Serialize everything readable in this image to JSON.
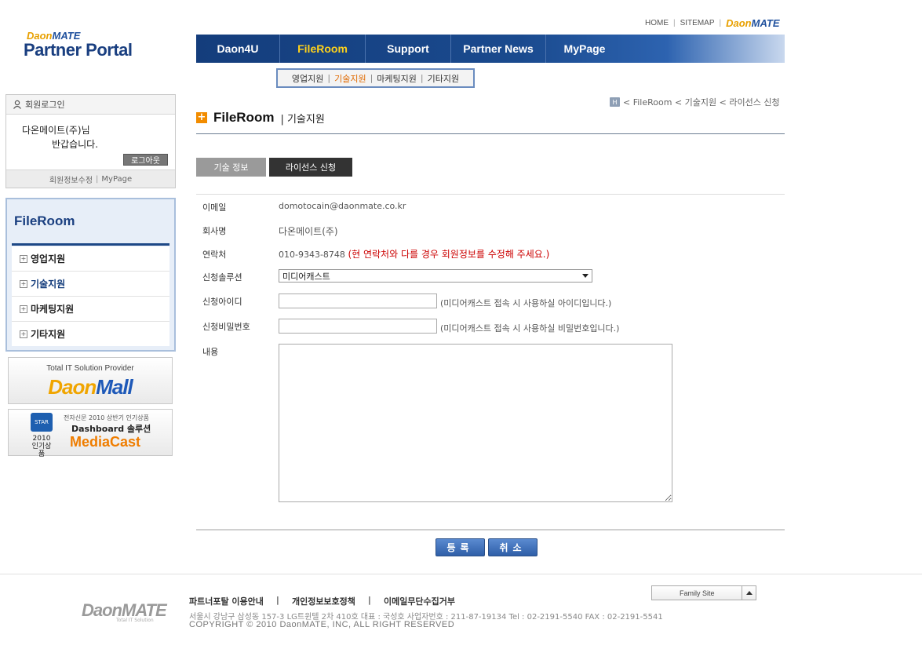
{
  "top_links": {
    "home": "HOME",
    "sitemap": "SITEMAP",
    "brand_a": "Daon",
    "brand_b": "MATE"
  },
  "logo": {
    "small_a": "Daon",
    "small_b": "MATE",
    "title": "Partner Portal"
  },
  "main_nav": [
    {
      "label": "Daon4U",
      "active": false
    },
    {
      "label": "FileRoom",
      "active": true
    },
    {
      "label": "Support",
      "active": false
    },
    {
      "label": "Partner News",
      "active": false
    },
    {
      "label": "MyPage",
      "active": false
    }
  ],
  "sub_nav": [
    "영업지원",
    "기술지원",
    "마케팅지원",
    "기타지원"
  ],
  "login": {
    "header": "회원로그인",
    "name": "다온메이트(주)님",
    "greeting": "반갑습니다.",
    "logout": "로그아웃",
    "edit_info": "회원정보수정",
    "mypage": "MyPage"
  },
  "side_menu": {
    "title": "FileRoom",
    "items": [
      "영업지원",
      "기술지원",
      "마케팅지원",
      "기타지원"
    ]
  },
  "banner1": {
    "line1": "Total IT Solution Provider",
    "logo_a": "Daon",
    "logo_b": "Mall"
  },
  "banner2": {
    "badge": "STAR",
    "year": "2010",
    "badge_sub": "인기상품",
    "line1": "전자신문 2010 상반기 인기상품",
    "line2": "Dashboard 솔루션",
    "line3": "MediaCast"
  },
  "breadcrumb": {
    "home_icon": "H",
    "path": "< FileRoom < 기술지원 < 라이선스 신청"
  },
  "page_title": {
    "main": "FileRoom",
    "sub": "| 기술지원"
  },
  "tabs": [
    {
      "label": "기술 정보",
      "active": false
    },
    {
      "label": "라이선스 신청",
      "active": true
    }
  ],
  "form": {
    "email_label": "이메일",
    "email_value": "domotocain@daonmate.co.kr",
    "company_label": "회사명",
    "company_value": "다온메이트(주)",
    "contact_label": "연락처",
    "contact_value": "010-9343-8748",
    "contact_warning": "(현 연락처와 다를 경우 회원정보를 수정해 주세요.)",
    "solution_label": "신청솔루션",
    "solution_value": "미디어캐스트",
    "id_label": "신청아이디",
    "id_value": "",
    "id_hint": "(미디어캐스트 접속 시 사용하실 아이디입니다.)",
    "pw_label": "신청비밀번호",
    "pw_value": "",
    "pw_hint": "(미디어캐스트 접속 시 사용하실 비밀번호입니다.)",
    "content_label": "내용",
    "content_value": ""
  },
  "buttons": {
    "submit": "등록",
    "cancel": "취소"
  },
  "footer": {
    "links": [
      "파트너포탈 이용안내",
      "개인정보보호정책",
      "이메일무단수집거부"
    ],
    "address": "서울시 강남구 삼성동 157-3 LG트윈텔 2차 410호    대표 : 국성호  사업자번호 : 211-87-19134    Tel : 02-2191-5540    FAX : 02-2191-5541",
    "copyright": "COPYRIGHT © 2010 DaonMATE, INC, ALL RIGHT RESERVED",
    "logo": "DaonMATE",
    "logo_sub": "Total IT Solution",
    "family_site": "Family Site"
  },
  "colors": {
    "nav_blue": "#143d7c",
    "active_nav": "#ffd21a",
    "accent_orange": "#f28c00",
    "warn_red": "#cc0000"
  }
}
